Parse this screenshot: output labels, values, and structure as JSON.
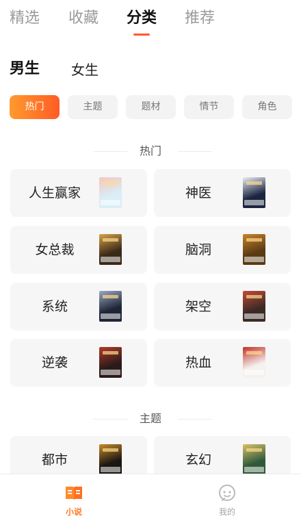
{
  "top_tabs": [
    {
      "label": "精选",
      "active": false
    },
    {
      "label": "收藏",
      "active": false
    },
    {
      "label": "分类",
      "active": true
    },
    {
      "label": "推荐",
      "active": false
    }
  ],
  "gender_tabs": [
    {
      "label": "男生",
      "active": true
    },
    {
      "label": "女生",
      "active": false
    }
  ],
  "category_chips": [
    {
      "label": "热门",
      "active": true
    },
    {
      "label": "主题",
      "active": false
    },
    {
      "label": "题材",
      "active": false
    },
    {
      "label": "情节",
      "active": false
    },
    {
      "label": "角色",
      "active": false
    }
  ],
  "sections": [
    {
      "title": "热门",
      "tags": [
        {
          "label": "人生赢家",
          "cover_color": "#d9eef7",
          "cover_accent": "#f3c7c0"
        },
        {
          "label": "神医",
          "cover_color": "#1c2540",
          "cover_accent": "#e8edf5"
        },
        {
          "label": "女总裁",
          "cover_color": "#3a2a18",
          "cover_accent": "#d7a24a"
        },
        {
          "label": "脑洞",
          "cover_color": "#5a3a14",
          "cover_accent": "#c7832c"
        },
        {
          "label": "系统",
          "cover_color": "#1e2636",
          "cover_accent": "#9aa7c2"
        },
        {
          "label": "架空",
          "cover_color": "#3b2a24",
          "cover_accent": "#c24a3a"
        },
        {
          "label": "逆袭",
          "cover_color": "#2b1a1a",
          "cover_accent": "#b23a2a"
        },
        {
          "label": "热血",
          "cover_color": "#f4f1ee",
          "cover_accent": "#c23028"
        }
      ]
    },
    {
      "title": "主题",
      "tags": [
        {
          "label": "都市",
          "cover_color": "#1a1612",
          "cover_accent": "#c78a2a"
        },
        {
          "label": "玄幻",
          "cover_color": "#2f5a3a",
          "cover_accent": "#d8c16a"
        }
      ]
    }
  ],
  "bottom_nav": [
    {
      "label": "小说",
      "icon": "book-icon",
      "active": true
    },
    {
      "label": "我的",
      "icon": "profile-icon",
      "active": false
    }
  ],
  "colors": {
    "accent": "#ff5a2c",
    "chip_gradient_start": "#ff9a2e",
    "chip_gradient_end": "#ff5c24",
    "nav_active": "#ff7a23"
  }
}
